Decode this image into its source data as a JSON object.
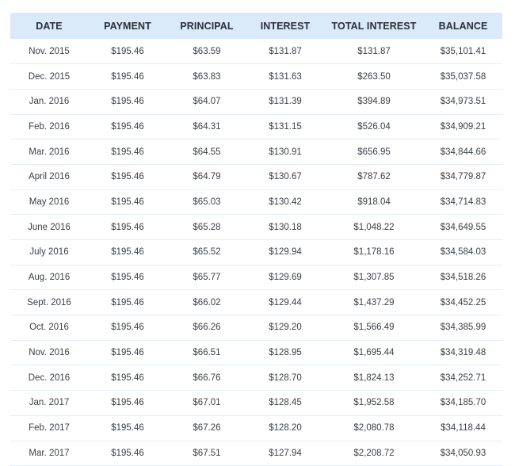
{
  "table": {
    "columns": [
      "DATE",
      "PAYMENT",
      "PRINCIPAL",
      "INTEREST",
      "TOTAL INTEREST",
      "BALANCE"
    ],
    "rows": [
      [
        "Nov. 2015",
        "$195.46",
        "$63.59",
        "$131.87",
        "$131.87",
        "$35,101.41"
      ],
      [
        "Dec. 2015",
        "$195.46",
        "$63.83",
        "$131.63",
        "$263.50",
        "$35,037.58"
      ],
      [
        "Jan. 2016",
        "$195.46",
        "$64.07",
        "$131.39",
        "$394.89",
        "$34,973.51"
      ],
      [
        "Feb. 2016",
        "$195.46",
        "$64.31",
        "$131.15",
        "$526.04",
        "$34,909.21"
      ],
      [
        "Mar. 2016",
        "$195.46",
        "$64.55",
        "$130.91",
        "$656.95",
        "$34,844.66"
      ],
      [
        "April 2016",
        "$195.46",
        "$64.79",
        "$130.67",
        "$787.62",
        "$34,779.87"
      ],
      [
        "May 2016",
        "$195.46",
        "$65.03",
        "$130.42",
        "$918.04",
        "$34,714.83"
      ],
      [
        "June 2016",
        "$195.46",
        "$65.28",
        "$130.18",
        "$1,048.22",
        "$34,649.55"
      ],
      [
        "July 2016",
        "$195.46",
        "$65.52",
        "$129.94",
        "$1,178.16",
        "$34,584.03"
      ],
      [
        "Aug. 2016",
        "$195.46",
        "$65.77",
        "$129.69",
        "$1,307.85",
        "$34,518.26"
      ],
      [
        "Sept. 2016",
        "$195.46",
        "$66.02",
        "$129.44",
        "$1,437.29",
        "$34,452.25"
      ],
      [
        "Oct. 2016",
        "$195.46",
        "$66.26",
        "$129.20",
        "$1,566.49",
        "$34,385.99"
      ],
      [
        "Nov. 2016",
        "$195.46",
        "$66.51",
        "$128.95",
        "$1,695.44",
        "$34,319.48"
      ],
      [
        "Dec. 2016",
        "$195.46",
        "$66.76",
        "$128.70",
        "$1,824.13",
        "$34,252.71"
      ],
      [
        "Jan. 2017",
        "$195.46",
        "$67.01",
        "$128.45",
        "$1,952.58",
        "$34,185.70"
      ],
      [
        "Feb. 2017",
        "$195.46",
        "$67.26",
        "$128.20",
        "$2,080.78",
        "$34,118.44"
      ],
      [
        "Mar. 2017",
        "$195.46",
        "$67.51",
        "$127.94",
        "$2,208.72",
        "$34,050.93"
      ]
    ]
  },
  "colors": {
    "header_bg": "#dbeaf9",
    "row_divider": "#e3eef8",
    "header_text": "#2a2f3a",
    "cell_text": "#3a3f47"
  }
}
